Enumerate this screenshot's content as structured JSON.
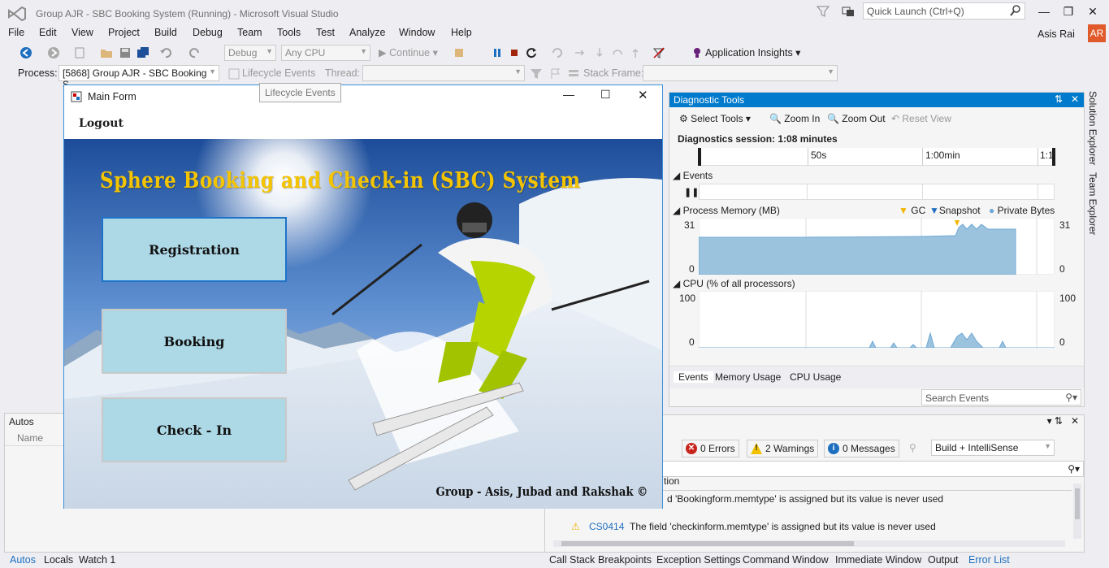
{
  "vs": {
    "title": "Group AJR - SBC Booking System (Running) - Microsoft Visual Studio",
    "quick_launch_placeholder": "Quick Launch (Ctrl+Q)",
    "user": "Asis Rai",
    "avatar": "AR",
    "menu": [
      "File",
      "Edit",
      "View",
      "Project",
      "Build",
      "Debug",
      "Team",
      "Tools",
      "Test",
      "Analyze",
      "Window",
      "Help"
    ],
    "toolbar": {
      "config": "Debug",
      "platform": "Any CPU",
      "continue": "Continue",
      "app_insights": "Application Insights"
    },
    "toolbar2": {
      "process_label": "Process:",
      "process_value": "[5868] Group AJR - SBC Booking S",
      "lifecycle": "Lifecycle Events",
      "thread_label": "Thread:",
      "stack_frame_label": "Stack Frame:",
      "tooltip": "Lifecycle Events"
    }
  },
  "form": {
    "title": "Main Form",
    "menu_logout": "Logout",
    "heading": "Sphere Booking and Check-in (SBC) System",
    "buttons": [
      "Registration",
      "Booking",
      "Check - In"
    ],
    "footer": "Group - Asis, Jubad and Rakshak ©"
  },
  "diagnostics": {
    "title": "Diagnostic Tools",
    "select_tools": "Select Tools",
    "zoom_in": "Zoom In",
    "zoom_out": "Zoom Out",
    "reset_view": "Reset View",
    "session": "Diagnostics session: 1:08 minutes",
    "ruler": [
      "50s",
      "1:00min",
      "1:1"
    ],
    "events_label": "Events",
    "memory_label": "Process Memory (MB)",
    "legend": [
      "GC",
      "Snapshot",
      "Private Bytes"
    ],
    "mem_max": "31",
    "mem_min": "0",
    "cpu_label": "CPU (% of all processors)",
    "cpu_max": "100",
    "cpu_min": "0",
    "tabs": [
      "Events",
      "Memory Usage",
      "CPU Usage"
    ],
    "search_placeholder": "Search Events"
  },
  "error_list": {
    "errors": "0 Errors",
    "warnings": "2 Warnings",
    "messages": "0 Messages",
    "scope": "Build + IntelliSense",
    "col_description": "tion",
    "rows": [
      {
        "code": "",
        "text": "d 'Bookingform.memtype' is assigned but its value is never used"
      },
      {
        "code": "CS0414",
        "text": "The field 'checkinform.memtype' is assigned but its value is never used"
      }
    ]
  },
  "autos": {
    "title": "Autos",
    "col_name": "Name"
  },
  "sidebar": [
    "Solution Explorer",
    "Team Explorer"
  ],
  "bottom_tabs_left": [
    "Autos",
    "Locals",
    "Watch 1"
  ],
  "bottom_tabs_right": [
    "Call Stack",
    "Breakpoints",
    "Exception Settings",
    "Command Window",
    "Immediate Window",
    "Output",
    "Error List"
  ]
}
